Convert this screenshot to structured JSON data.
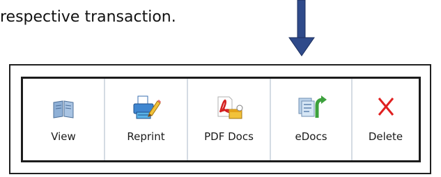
{
  "caption": "respective transaction.",
  "arrow_color": "#2f4a8a",
  "toolbar": {
    "buttons": [
      {
        "id": "view",
        "label": "View",
        "icon": "book-icon"
      },
      {
        "id": "reprint",
        "label": "Reprint",
        "icon": "printer-pencil-icon"
      },
      {
        "id": "pdf_docs",
        "label": "PDF Docs",
        "icon": "pdf-documents-icon"
      },
      {
        "id": "edocs",
        "label": "eDocs",
        "icon": "documents-return-arrow-icon"
      },
      {
        "id": "delete",
        "label": "Delete",
        "icon": "red-x-icon"
      }
    ]
  }
}
